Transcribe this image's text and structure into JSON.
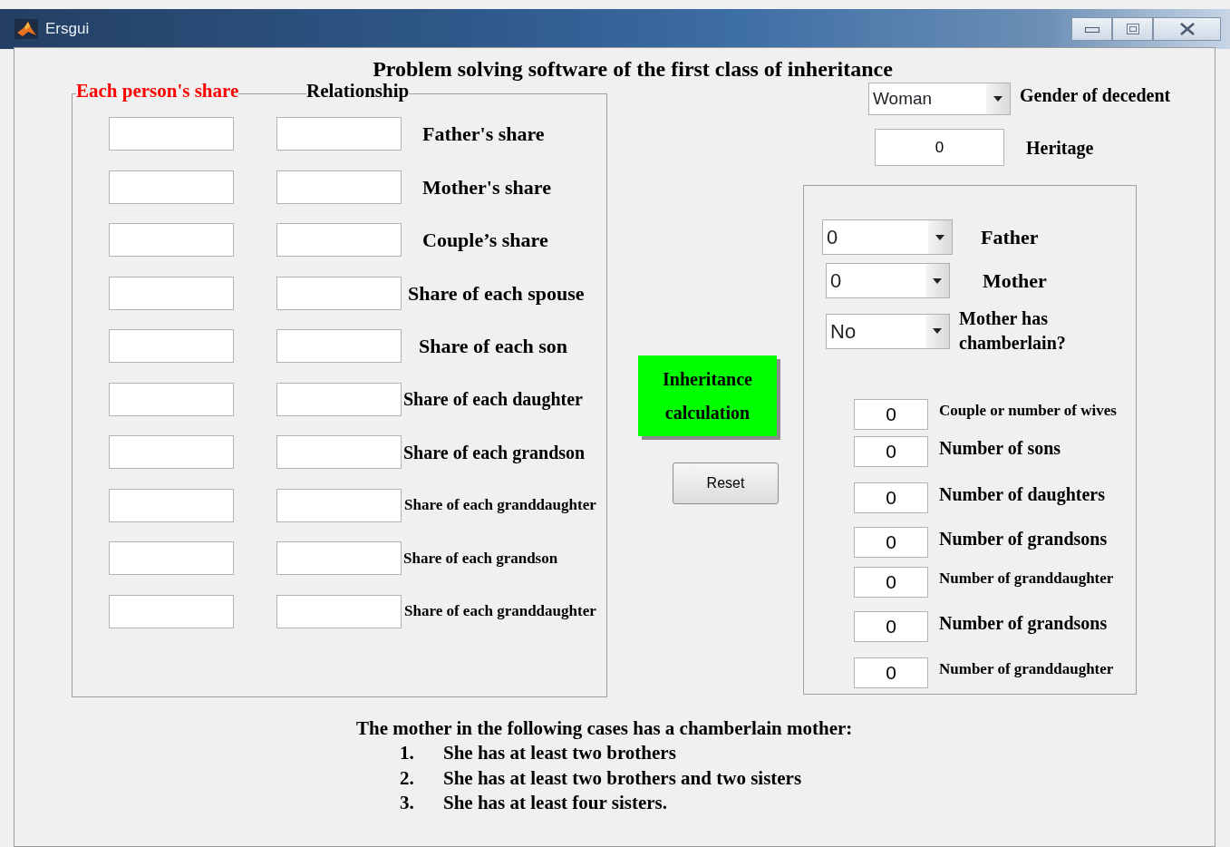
{
  "window": {
    "title": "Ersgui"
  },
  "heading": "Problem solving software of the first class of inheritance",
  "shares_panel": {
    "legend": "Each person's share",
    "legend_2": "Relationship",
    "rows": [
      {
        "label": "Father's share"
      },
      {
        "label": "Mother's share"
      },
      {
        "label": "Couple’s share"
      },
      {
        "label": "Share of each spouse"
      },
      {
        "label": "Share of each son"
      },
      {
        "label": "Share of each daughter"
      },
      {
        "label": "Share of each grandson"
      },
      {
        "label": "Share of each granddaughter"
      },
      {
        "label": "Share of each grandson"
      },
      {
        "label": "Share of each granddaughter"
      }
    ]
  },
  "calculate_button": "Inheritance calculation",
  "reset_button": "Reset",
  "decedent_gender": {
    "value": "Woman",
    "label": "Gender of decedent"
  },
  "heritage": {
    "value": "0",
    "label": "Heritage"
  },
  "relatives_panel": {
    "dropdowns": [
      {
        "value": "0",
        "label": "Father"
      },
      {
        "value": "0",
        "label": "Mother"
      },
      {
        "value": "No",
        "label": "Mother has chamberlain?"
      }
    ],
    "counts": [
      {
        "value": "0",
        "label": "Couple or number of wives"
      },
      {
        "value": "0",
        "label": "Number of sons"
      },
      {
        "value": "0",
        "label": "Number of daughters"
      },
      {
        "value": "0",
        "label": "Number of grandsons"
      },
      {
        "value": "0",
        "label": "Number of granddaughter"
      },
      {
        "value": "0",
        "label": "Number of grandsons"
      },
      {
        "value": "0",
        "label": "Number of granddaughter"
      }
    ]
  },
  "note": {
    "title": "The mother in the following cases has a chamberlain mother:",
    "items": [
      {
        "number": "1.",
        "text": "She has at least two brothers"
      },
      {
        "number": "2.",
        "text": "She has at least two brothers and two sisters"
      },
      {
        "number": "3.",
        "text": "She has at least four sisters."
      }
    ]
  }
}
